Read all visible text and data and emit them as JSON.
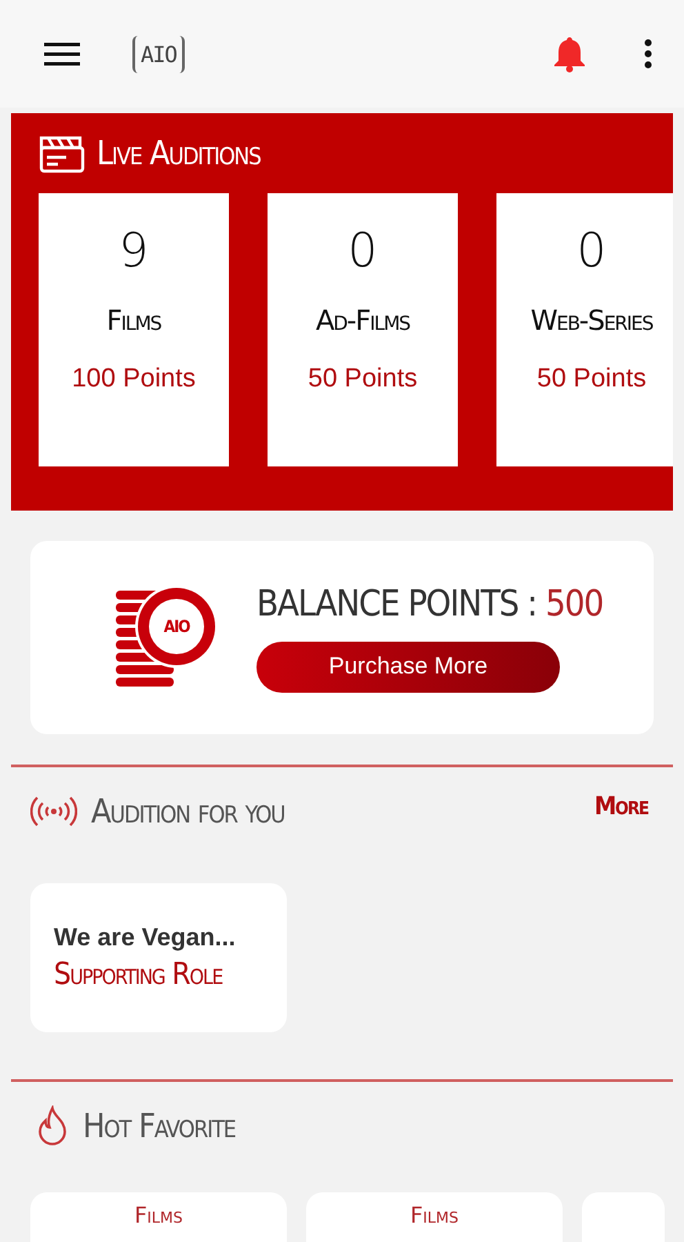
{
  "header": {
    "logo": "AIO"
  },
  "live_auditions": {
    "title": "Live Auditions",
    "categories": [
      {
        "count": "9",
        "name": "Films",
        "points": "100 Points"
      },
      {
        "count": "0",
        "name": "Ad-Films",
        "points": "50 Points"
      },
      {
        "count": "0",
        "name": "Web-Series",
        "points": "50 Points"
      }
    ]
  },
  "balance": {
    "coin_label": "AIO",
    "label": "BALANCE POINTS : ",
    "value": "500",
    "button": "Purchase More"
  },
  "audition_for_you": {
    "title": "Audition for you",
    "more": "More",
    "cards": [
      {
        "title": "We are Vegan...",
        "role": "Supporting Role"
      }
    ]
  },
  "hot_favorite": {
    "title": "Hot Favorite",
    "cards": [
      {
        "label": "Films"
      },
      {
        "label": "Films"
      },
      {
        "kind": "empty"
      }
    ]
  }
}
